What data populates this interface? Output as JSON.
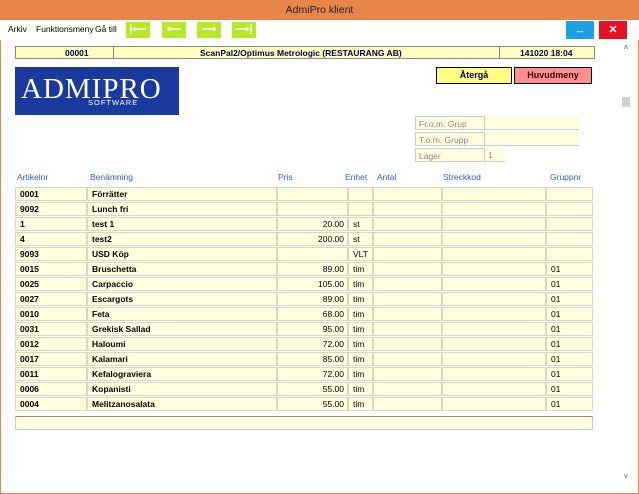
{
  "window": {
    "title": "AdmiPro klient",
    "minimize": "_",
    "close": "✕"
  },
  "menu": [
    "Arkiv",
    "Funktionsmeny",
    "Gå till"
  ],
  "nav": {
    "first": "|⟵",
    "prev": "⟵",
    "next": "⟶",
    "last": "⟶|"
  },
  "header": {
    "id": "00001",
    "title": "ScanPal2/Optimus Metrologic (RESTAURANG AB)",
    "datetime": "141020 18:04"
  },
  "logo": {
    "main": "ADMIPRO",
    "sub": "SOFTWARE"
  },
  "buttons": {
    "back": "Återgå",
    "main_menu": "Huvudmeny"
  },
  "filters": [
    {
      "label": "Fr.o.m. Grup",
      "value": ""
    },
    {
      "label": "T.o.m. Grupp",
      "value": ""
    },
    {
      "label": "Lager",
      "value": "1"
    }
  ],
  "columns": {
    "artnr": "Artikelnr",
    "name": "Benämning",
    "price": "Pris",
    "unit": "Enhet",
    "qty": "Antal",
    "barcode": "Streckkod",
    "group": "Gruppnr"
  },
  "rows": [
    {
      "artnr": "0001",
      "name": "Förrätter",
      "price": "",
      "unit": "",
      "group": ""
    },
    {
      "artnr": "9092",
      "name": "Lunch fri",
      "price": "",
      "unit": "",
      "group": ""
    },
    {
      "artnr": "1",
      "name": "test 1",
      "price": "20.00",
      "unit": "st",
      "group": ""
    },
    {
      "artnr": "4",
      "name": "test2",
      "price": "200.00",
      "unit": "st",
      "group": ""
    },
    {
      "artnr": "9093",
      "name": "USD Köp",
      "price": "",
      "unit": "VLT",
      "group": ""
    },
    {
      "artnr": "0015",
      "name": "Bruschetta",
      "price": "89.00",
      "unit": "tim",
      "group": "01"
    },
    {
      "artnr": "0025",
      "name": "Carpaccio",
      "price": "105.00",
      "unit": "tim",
      "group": "01"
    },
    {
      "artnr": "0027",
      "name": "Escargots",
      "price": "89.00",
      "unit": "tim",
      "group": "01"
    },
    {
      "artnr": "0010",
      "name": "Feta",
      "price": "68.00",
      "unit": "tim",
      "group": "01"
    },
    {
      "artnr": "0031",
      "name": "Grekisk Sallad",
      "price": "95.00",
      "unit": "tim",
      "group": "01"
    },
    {
      "artnr": "0012",
      "name": "Haloumi",
      "price": "72.00",
      "unit": "tim",
      "group": "01"
    },
    {
      "artnr": "0017",
      "name": "Kalamari",
      "price": "85.00",
      "unit": "tim",
      "group": "01"
    },
    {
      "artnr": "0011",
      "name": "Kefalograviera",
      "price": "72.00",
      "unit": "tim",
      "group": "01"
    },
    {
      "artnr": "0006",
      "name": "Kopanisti",
      "price": "55.00",
      "unit": "tim",
      "group": "01"
    },
    {
      "artnr": "0004",
      "name": "Melitzanosalata",
      "price": "55.00",
      "unit": "tim",
      "group": "01"
    }
  ],
  "scrollbar": {
    "up": "˄",
    "down": "˅"
  },
  "colors": {
    "titlebar": "#E8864A",
    "nav": "#B9E82B",
    "header_bg": "#FFFFC0",
    "logo_bg": "#1A3A9E",
    "back_btn": "#FFFF80",
    "main_btn": "#FF9090",
    "col_head": "#3060C0"
  }
}
